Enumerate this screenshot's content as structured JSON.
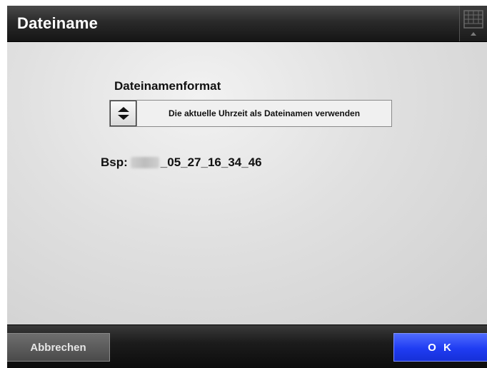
{
  "window": {
    "title": "Dateiname"
  },
  "format": {
    "label": "Dateinamenformat",
    "selected_value": "Die aktuelle Uhrzeit als Dateinamen verwenden"
  },
  "example": {
    "prefix": "Bsp:",
    "suffix": "_05_27_16_34_46"
  },
  "footer": {
    "cancel_label": "Abbrechen",
    "ok_label": "O K"
  },
  "icons": {
    "keyboard": "keyboard-icon",
    "select_arrows": "up-down-arrows-icon"
  },
  "colors": {
    "ok_button": "#1f3cf2",
    "title_bar": "#2a2a2a"
  }
}
